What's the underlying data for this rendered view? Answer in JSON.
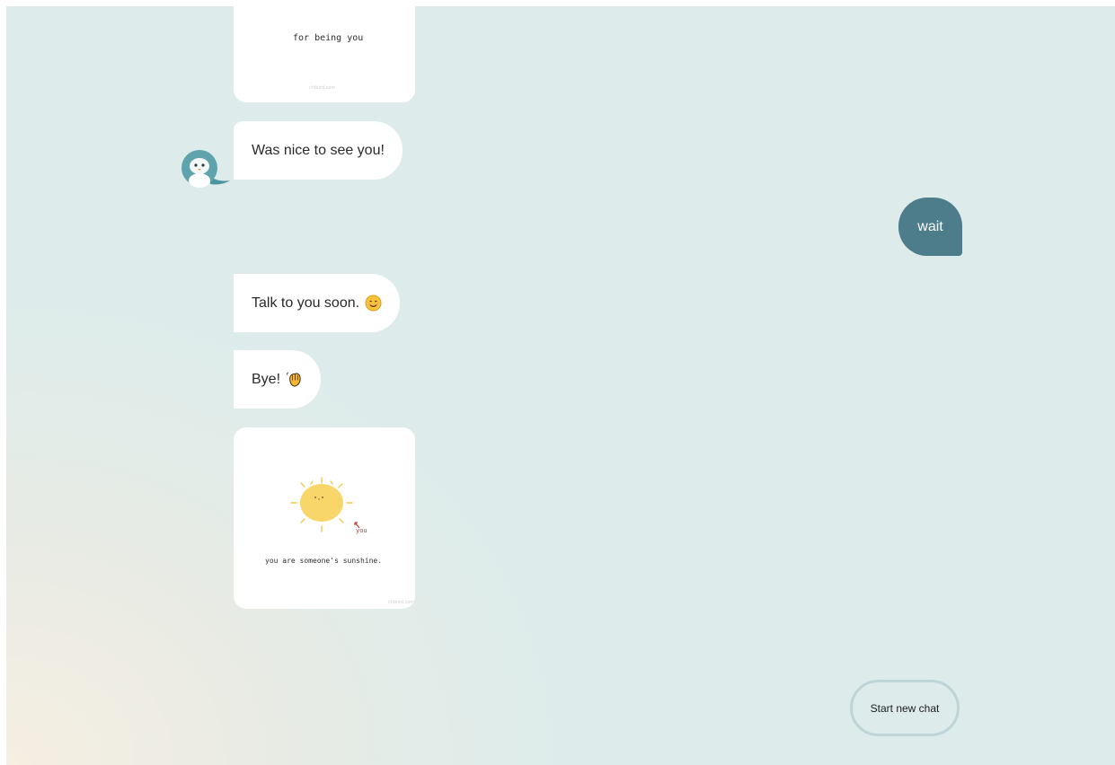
{
  "messages": {
    "card_top": {
      "caption": "for being you",
      "watermark": "chibird.com"
    },
    "nice_to_see": "Was nice to see you!",
    "user_reply": "wait",
    "talk_soon": "Talk to you soon.",
    "talk_soon_emoji": "smiling-face-icon",
    "bye": "Bye!",
    "bye_emoji": "waving-hand-icon",
    "card_bottom": {
      "arrow_label": "you",
      "caption": "you are someone's sunshine.",
      "watermark": "chibird.com"
    }
  },
  "actions": {
    "new_chat_label": "Start new chat"
  },
  "colors": {
    "background": "#ddeceb",
    "user_bubble": "#4d7c8a",
    "bot_bubble": "#ffffff",
    "sun": "#f9d66a",
    "avatar": "#5fa3ad"
  }
}
